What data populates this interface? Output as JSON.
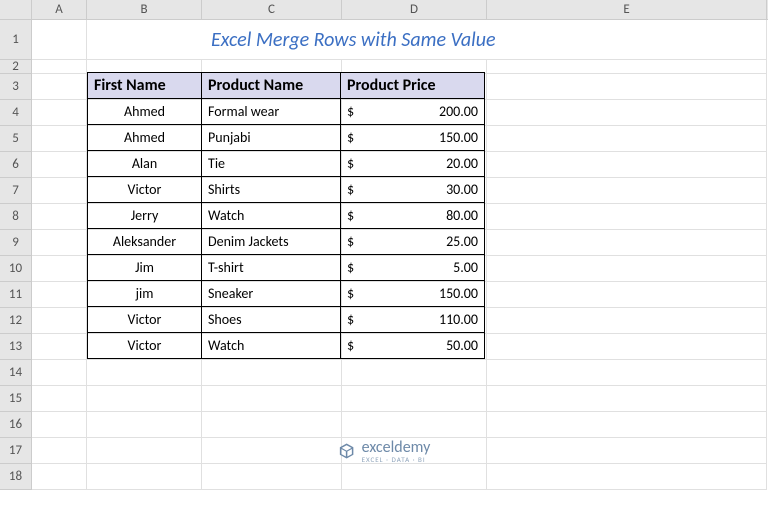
{
  "columns": [
    "A",
    "B",
    "C",
    "D",
    "E"
  ],
  "col_widths": {
    "A": 55,
    "B": 115,
    "C": 140,
    "D": 145,
    "E": 280
  },
  "rows": [
    "1",
    "2",
    "3",
    "4",
    "5",
    "6",
    "7",
    "8",
    "9",
    "10",
    "11",
    "12",
    "13",
    "14",
    "15",
    "16",
    "17",
    "18"
  ],
  "title": "Excel Merge Rows with Same Value",
  "table": {
    "headers": [
      "First Name",
      "Product Name",
      "Product Price"
    ],
    "rows": [
      {
        "name": "Ahmed",
        "product": "Formal wear",
        "currency": "$",
        "price": "200.00"
      },
      {
        "name": "Ahmed",
        "product": "Punjabi",
        "currency": "$",
        "price": "150.00"
      },
      {
        "name": "Alan",
        "product": "Tie",
        "currency": "$",
        "price": "20.00"
      },
      {
        "name": "Victor",
        "product": "Shirts",
        "currency": "$",
        "price": "30.00"
      },
      {
        "name": "Jerry",
        "product": "Watch",
        "currency": "$",
        "price": "80.00"
      },
      {
        "name": "Aleksander",
        "product": "Denim Jackets",
        "currency": "$",
        "price": "25.00"
      },
      {
        "name": "Jim",
        "product": "T-shirt",
        "currency": "$",
        "price": "5.00"
      },
      {
        "name": "jim",
        "product": "Sneaker",
        "currency": "$",
        "price": "150.00"
      },
      {
        "name": "Victor",
        "product": "Shoes",
        "currency": "$",
        "price": "110.00"
      },
      {
        "name": "Victor",
        "product": "Watch",
        "currency": "$",
        "price": "50.00"
      }
    ]
  },
  "logo": {
    "name": "exceldemy",
    "tagline": "EXCEL · DATA · BI"
  }
}
